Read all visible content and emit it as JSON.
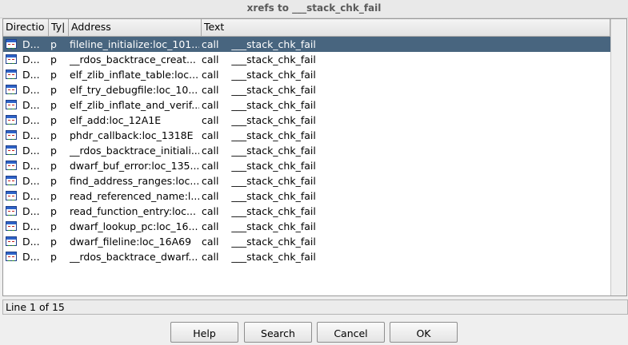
{
  "window": {
    "title": "xrefs to ___stack_chk_fail"
  },
  "columns": [
    "Directio",
    "Ty|",
    "Address",
    "Text"
  ],
  "rows": [
    {
      "dir": "D...",
      "type": "p",
      "address": "fileline_initialize:loc_101...",
      "text": "call    ___stack_chk_fail"
    },
    {
      "dir": "D...",
      "type": "p",
      "address": "__rdos_backtrace_creat...",
      "text": "call    ___stack_chk_fail"
    },
    {
      "dir": "D...",
      "type": "p",
      "address": "elf_zlib_inflate_table:loc...",
      "text": "call    ___stack_chk_fail"
    },
    {
      "dir": "D...",
      "type": "p",
      "address": "elf_try_debugfile:loc_10...",
      "text": "call    ___stack_chk_fail"
    },
    {
      "dir": "D...",
      "type": "p",
      "address": "elf_zlib_inflate_and_verif...",
      "text": "call    ___stack_chk_fail"
    },
    {
      "dir": "D...",
      "type": "p",
      "address": "elf_add:loc_12A1E",
      "text": "call    ___stack_chk_fail"
    },
    {
      "dir": "D...",
      "type": "p",
      "address": "phdr_callback:loc_1318E",
      "text": "call    ___stack_chk_fail"
    },
    {
      "dir": "D...",
      "type": "p",
      "address": "__rdos_backtrace_initiali...",
      "text": "call    ___stack_chk_fail"
    },
    {
      "dir": "D...",
      "type": "p",
      "address": "dwarf_buf_error:loc_135...",
      "text": "call    ___stack_chk_fail"
    },
    {
      "dir": "D...",
      "type": "p",
      "address": "find_address_ranges:loc...",
      "text": "call    ___stack_chk_fail"
    },
    {
      "dir": "D...",
      "type": "p",
      "address": "read_referenced_name:l...",
      "text": "call    ___stack_chk_fail"
    },
    {
      "dir": "D...",
      "type": "p",
      "address": "read_function_entry:loc...",
      "text": "call    ___stack_chk_fail"
    },
    {
      "dir": "D...",
      "type": "p",
      "address": "dwarf_lookup_pc:loc_16...",
      "text": "call    ___stack_chk_fail"
    },
    {
      "dir": "D...",
      "type": "p",
      "address": "dwarf_fileline:loc_16A69",
      "text": "call    ___stack_chk_fail"
    },
    {
      "dir": "D...",
      "type": "p",
      "address": "__rdos_backtrace_dwarf...",
      "text": "call    ___stack_chk_fail"
    }
  ],
  "status": "Line 1 of 15",
  "buttons": {
    "help": "Help",
    "search": "Search",
    "cancel": "Cancel",
    "ok": "OK"
  },
  "colors": {
    "selection": "#48657f",
    "icon": "#2e63c8"
  }
}
